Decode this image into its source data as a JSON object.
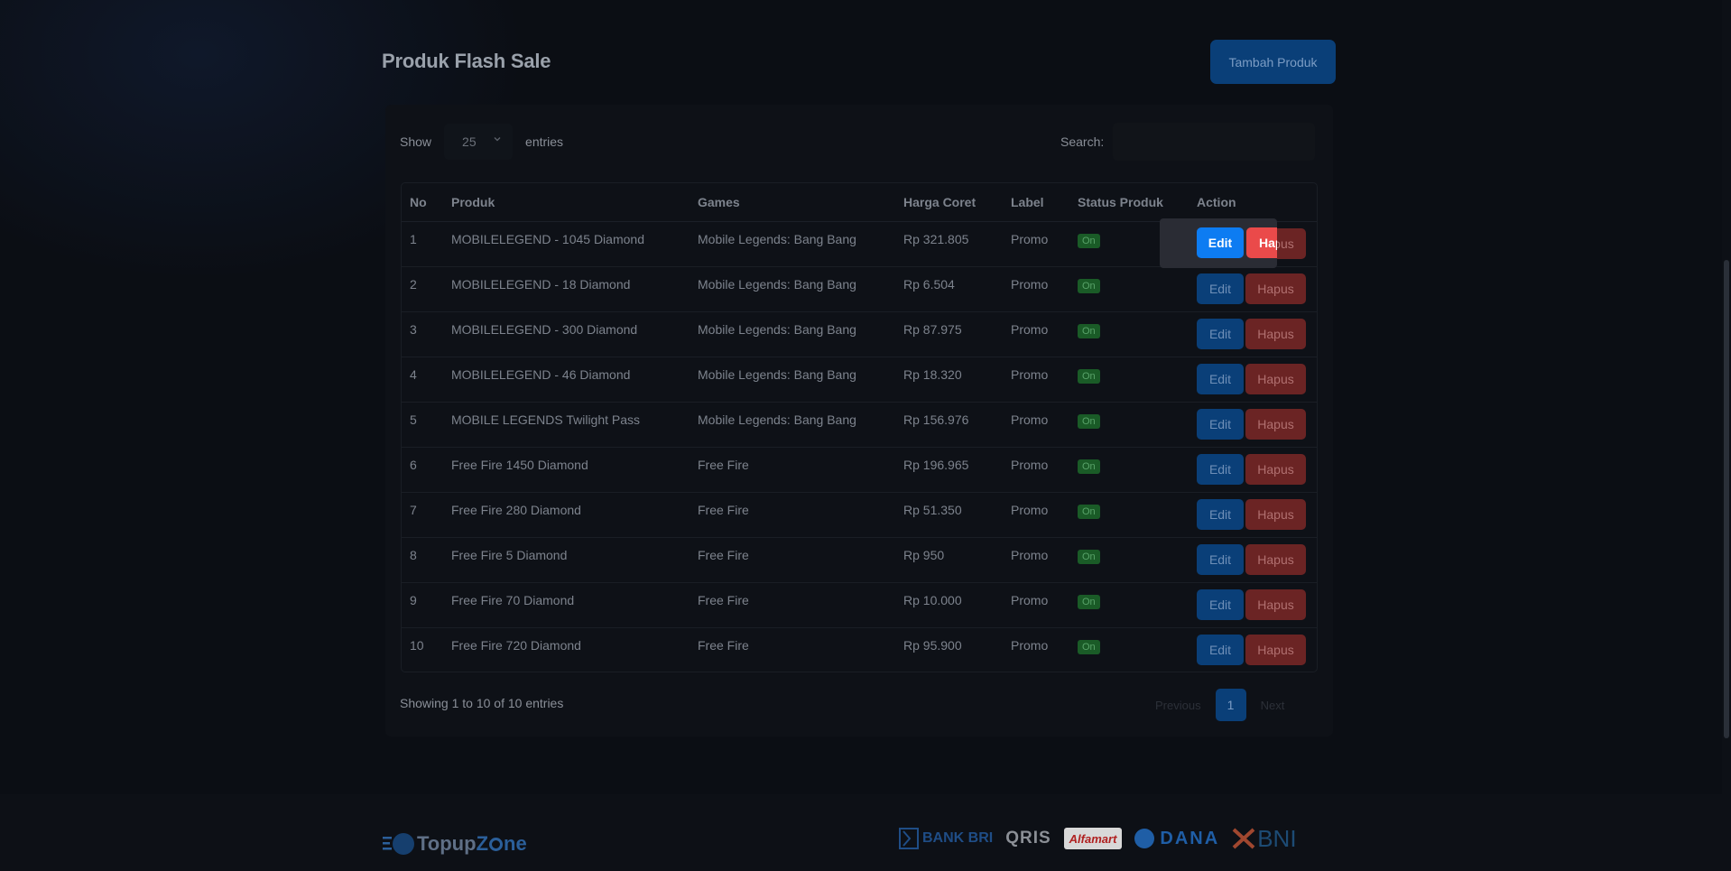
{
  "page": {
    "title": "Produk Flash Sale",
    "add_button": "Tambah Produk"
  },
  "datatable": {
    "show_label": "Show",
    "entries_value": "25",
    "entries_label": "entries",
    "search_label": "Search:",
    "search_value": "",
    "info": "Showing 1 to 10 of 10 entries",
    "pager": {
      "previous": "Previous",
      "current": "1",
      "next": "Next"
    }
  },
  "table": {
    "headers": [
      "No",
      "Produk",
      "Games",
      "Harga Coret",
      "Label",
      "Status Produk",
      "Action"
    ],
    "rows": [
      {
        "no": "1",
        "produk": "MOBILELEGEND - 1045 Diamond",
        "games": "Mobile Legends: Bang Bang",
        "harga": "Rp 321.805",
        "label": "Promo",
        "status": "On"
      },
      {
        "no": "2",
        "produk": "MOBILELEGEND - 18 Diamond",
        "games": "Mobile Legends: Bang Bang",
        "harga": "Rp 6.504",
        "label": "Promo",
        "status": "On"
      },
      {
        "no": "3",
        "produk": "MOBILELEGEND - 300 Diamond",
        "games": "Mobile Legends: Bang Bang",
        "harga": "Rp 87.975",
        "label": "Promo",
        "status": "On"
      },
      {
        "no": "4",
        "produk": "MOBILELEGEND - 46 Diamond",
        "games": "Mobile Legends: Bang Bang",
        "harga": "Rp 18.320",
        "label": "Promo",
        "status": "On"
      },
      {
        "no": "5",
        "produk": "MOBILE LEGENDS Twilight Pass",
        "games": "Mobile Legends: Bang Bang",
        "harga": "Rp 156.976",
        "label": "Promo",
        "status": "On"
      },
      {
        "no": "6",
        "produk": "Free Fire 1450 Diamond",
        "games": "Free Fire",
        "harga": "Rp 196.965",
        "label": "Promo",
        "status": "On"
      },
      {
        "no": "7",
        "produk": "Free Fire 280 Diamond",
        "games": "Free Fire",
        "harga": "Rp 51.350",
        "label": "Promo",
        "status": "On"
      },
      {
        "no": "8",
        "produk": "Free Fire 5 Diamond",
        "games": "Free Fire",
        "harga": "Rp 950",
        "label": "Promo",
        "status": "On"
      },
      {
        "no": "9",
        "produk": "Free Fire 70 Diamond",
        "games": "Free Fire",
        "harga": "Rp 10.000",
        "label": "Promo",
        "status": "On"
      },
      {
        "no": "10",
        "produk": "Free Fire 720 Diamond",
        "games": "Free Fire",
        "harga": "Rp 95.900",
        "label": "Promo",
        "status": "On"
      }
    ],
    "edit_label": "Edit",
    "delete_label": "Hapus"
  },
  "spotlight": {
    "edit": "Edit",
    "delete_partial": "Hapus"
  },
  "footer": {
    "logo_text_a": "Topup",
    "logo_text_b": "Z",
    "logo_text_c": "ne",
    "payments": [
      "BANK BRI",
      "QRIS",
      "Alfamart",
      "DANA",
      "BNI"
    ]
  },
  "colors": {
    "accent": "#0d7cf2",
    "danger": "#ea4a4a",
    "success": "#1a5b27",
    "background": "#0b0e14"
  }
}
